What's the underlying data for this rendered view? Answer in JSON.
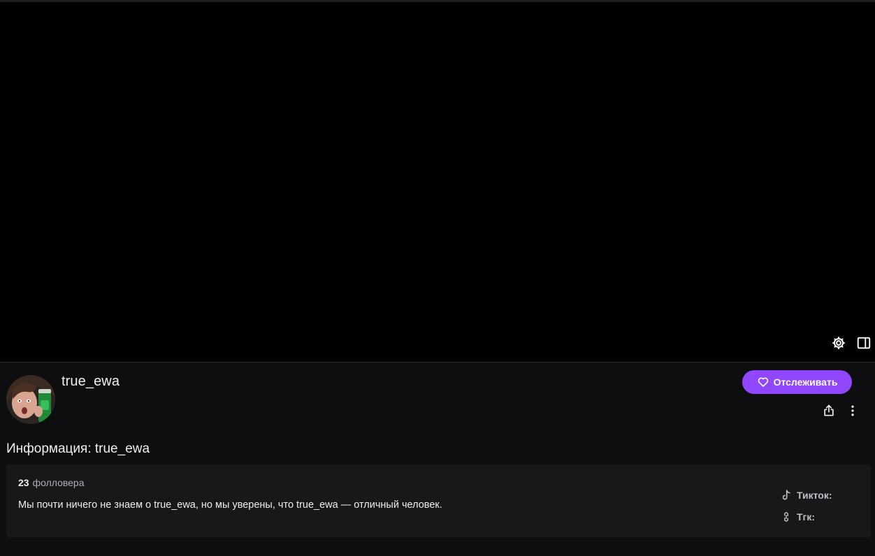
{
  "channel": {
    "name": "true_ewa",
    "follow_label": "Отслеживать"
  },
  "about": {
    "title": "Информация: true_ewa",
    "followers_count": "23",
    "followers_label": "фолловера",
    "bio": "Мы почти ничего не знаем о true_ewa, но мы уверены, что true_ewa — отличный человек.",
    "links": [
      {
        "label": "Тикток:",
        "icon": "tiktok-icon"
      },
      {
        "label": "Тгк:",
        "icon": "link-icon"
      }
    ]
  },
  "colors": {
    "accent": "#9147ff",
    "background": "#0e0e10",
    "panel": "#18181b",
    "player": "#000000"
  }
}
